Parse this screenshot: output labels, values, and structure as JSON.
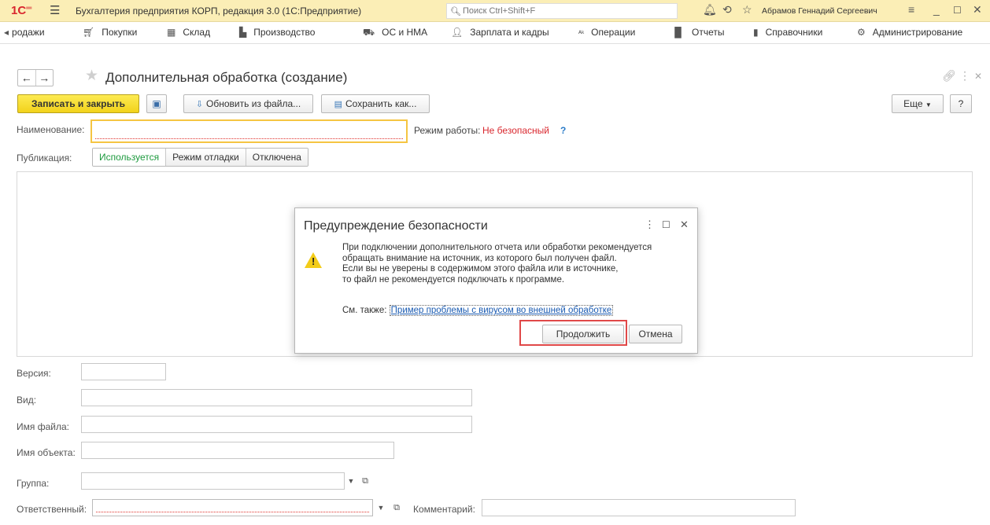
{
  "titlebar": {
    "logo": "1С",
    "title": "Бухгалтерия предприятия КОРП, редакция 3.0  (1С:Предприятие)",
    "search_placeholder": "Поиск Ctrl+Shift+F",
    "user": "Абрамов Геннадий Сергеевич"
  },
  "sections": [
    {
      "label": "родажи",
      "icon": "chevron-left-icon"
    },
    {
      "label": "Покупки",
      "icon": "cart-icon"
    },
    {
      "label": "Склад",
      "icon": "warehouse-icon"
    },
    {
      "label": "Производство",
      "icon": "factory-icon"
    },
    {
      "label": "ОС и НМА",
      "icon": "truck-icon"
    },
    {
      "label": "Зарплата и кадры",
      "icon": "person-icon"
    },
    {
      "label": "Операции",
      "icon": "operations-icon"
    },
    {
      "label": "Отчеты",
      "icon": "report-icon"
    },
    {
      "label": "Справочники",
      "icon": "book-icon"
    },
    {
      "label": "Администрирование",
      "icon": "gear-icon"
    }
  ],
  "form": {
    "title": "Дополнительная обработка (создание)",
    "toolbar": {
      "save_close": "Записать и закрыть",
      "update_from_file": "Обновить из файла...",
      "save_as": "Сохранить как...",
      "more": "Еще",
      "help": "?"
    },
    "name_label": "Наименование:",
    "name_value": "",
    "mode_label": "Режим работы:",
    "mode_value": "Не безопасный",
    "mode_help": "?",
    "publication_label": "Публикация:",
    "publication_options": [
      "Используется",
      "Режим отладки",
      "Отключена"
    ],
    "publication_selected": "Используется",
    "version_label": "Версия:",
    "kind_label": "Вид:",
    "filename_label": "Имя файла:",
    "objectname_label": "Имя объекта:",
    "group_label": "Группа:",
    "responsible_label": "Ответственный:",
    "comment_label": "Комментарий:"
  },
  "dialog": {
    "title": "Предупреждение безопасности",
    "text_lines": [
      "При подключении дополнительного отчета или обработки рекомендуется",
      "обращать внимание на источник, из которого был получен файл.",
      "Если вы не уверены в содержимом этого файла или в источнике,",
      "то файл не рекомендуется подключать к программе."
    ],
    "see_also": "См. также:",
    "link": "Пример проблемы с вирусом во внешней обработке",
    "continue": "Продолжить",
    "cancel": "Отмена"
  }
}
